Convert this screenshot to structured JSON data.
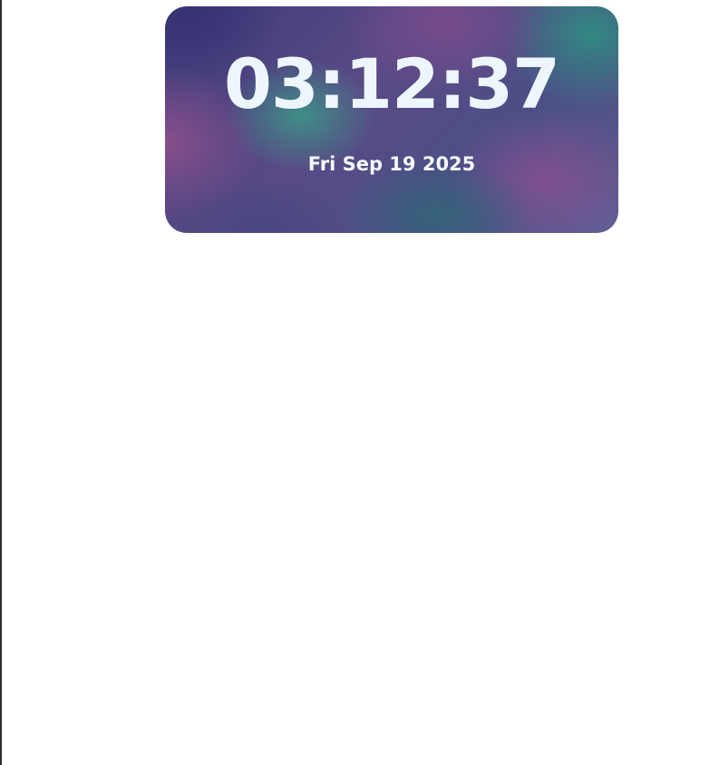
{
  "clock": {
    "time": "03:12:37",
    "date": "Fri Sep 19 2025"
  },
  "colors": {
    "card_text": "#eef6fd",
    "gradient_purple": "#784b8c",
    "gradient_teal": "#308c82",
    "gradient_indigo": "#37327a",
    "page_background": "#ffffff"
  }
}
